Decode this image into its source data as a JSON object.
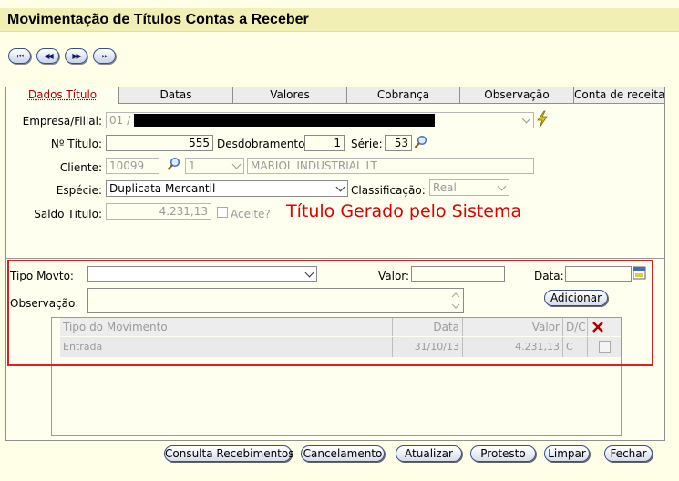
{
  "window": {
    "title": "Movimentação de Títulos Contas a Receber"
  },
  "nav": {
    "first": "⏮",
    "prev": "◀◀",
    "next": "▶▶",
    "last": "⏭"
  },
  "tabs": [
    {
      "label": "Dados Título",
      "active": true
    },
    {
      "label": "Datas"
    },
    {
      "label": "Valores"
    },
    {
      "label": "Cobrança"
    },
    {
      "label": "Observação"
    },
    {
      "label": "Conta de receita"
    }
  ],
  "form": {
    "empresa_label": "Empresa/Filial:",
    "empresa_value": "01 /",
    "titulo_label": "Nº Título:",
    "titulo_value": "555",
    "desdobramento_label": "Desdobramento:",
    "desdobramento_value": "1",
    "serie_label": "Série:",
    "serie_value": "53",
    "cliente_label": "Cliente:",
    "cliente_code": "10099",
    "cliente_seq": "1",
    "cliente_name": "MARIOL INDUSTRIAL LT",
    "especie_label": "Espécie:",
    "especie_value": "Duplicata Mercantil",
    "classificacao_label": "Classificação:",
    "classificacao_value": "Real",
    "saldo_label": "Saldo Título:",
    "saldo_value": "4.231,13",
    "aceite_label": "Aceite?",
    "annotation": "Título Gerado pelo Sistema"
  },
  "movimento": {
    "tipo_label": "Tipo Movto:",
    "tipo_value": "",
    "valor_label": "Valor:",
    "valor_value": "",
    "data_label": "Data:",
    "data_value": "",
    "obs_label": "Observação:",
    "obs_value": "",
    "add_button": "Adicionar"
  },
  "grid": {
    "headers": {
      "tipo": "Tipo do Movimento",
      "data": "Data",
      "valor": "Valor",
      "dc": "D/C"
    },
    "rows": [
      {
        "tipo": "Entrada",
        "data": "31/10/13",
        "valor": "4.231,13",
        "dc": "C"
      }
    ]
  },
  "buttons": {
    "consulta": "Consulta Recebimentos",
    "cancelamento": "Cancelamento",
    "atualizar": "Atualizar",
    "protesto": "Protesto",
    "limpar": "Limpar",
    "fechar": "Fechar"
  },
  "colors": {
    "accent_red": "#E00000",
    "title_bg": "#F2EFB5",
    "page_bg": "#FFFFE8"
  }
}
